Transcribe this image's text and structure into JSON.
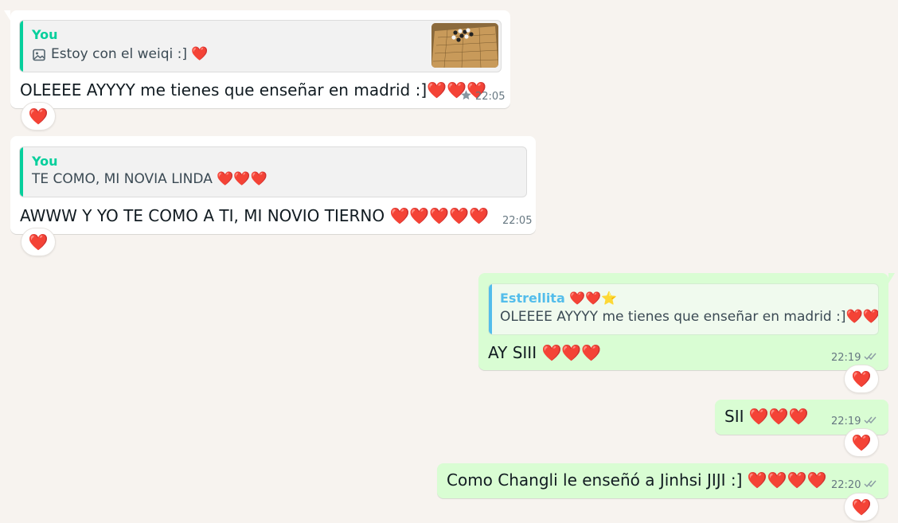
{
  "messages": [
    {
      "direction": "incoming",
      "reply": {
        "author": "You",
        "text": "Estoy con el weiqi :] ❤️",
        "has_photo": true,
        "thumbnail": "go-board-photo"
      },
      "text": "OLEEEE AYYYY me tienes que enseñar en madrid :]❤️❤️❤️",
      "time": "22:05",
      "starred": true,
      "reaction": "❤️"
    },
    {
      "direction": "incoming",
      "reply": {
        "author": "You",
        "text": "TE COMO, MI NOVIA LINDA ❤️❤️❤️"
      },
      "text": "AWWW Y YO TE COMO A TI, MI NOVIO TIERNO ❤️❤️❤️❤️❤️",
      "time": "22:05",
      "reaction": "❤️"
    },
    {
      "direction": "outgoing",
      "reply": {
        "author": "Estrellita ❤️❤️⭐",
        "text": "OLEEEE AYYYY me tienes que enseñar en madrid :]❤️❤️❤️"
      },
      "text": "AY SIII ❤️❤️❤️",
      "time": "22:19",
      "status": "read",
      "reaction": "❤️"
    },
    {
      "direction": "outgoing",
      "text": "SII ❤️❤️❤️",
      "time": "22:19",
      "status": "read",
      "reaction": "❤️"
    },
    {
      "direction": "outgoing",
      "text": "Como Changli le enseñó a Jinhsi JIJI :] ❤️❤️❤️❤️",
      "time": "22:20",
      "status": "read",
      "reaction": "❤️"
    }
  ],
  "colors": {
    "background": "#f7f3ef",
    "incoming_bubble": "#ffffff",
    "outgoing_bubble": "#d9fdd3",
    "you_author": "#06cf9c",
    "estrellita_author": "#53bdeb",
    "read_ticks": "#8a9aa3"
  },
  "icons": {
    "photo": "image-icon",
    "star": "star-icon",
    "read_receipt": "double-check-icon"
  }
}
